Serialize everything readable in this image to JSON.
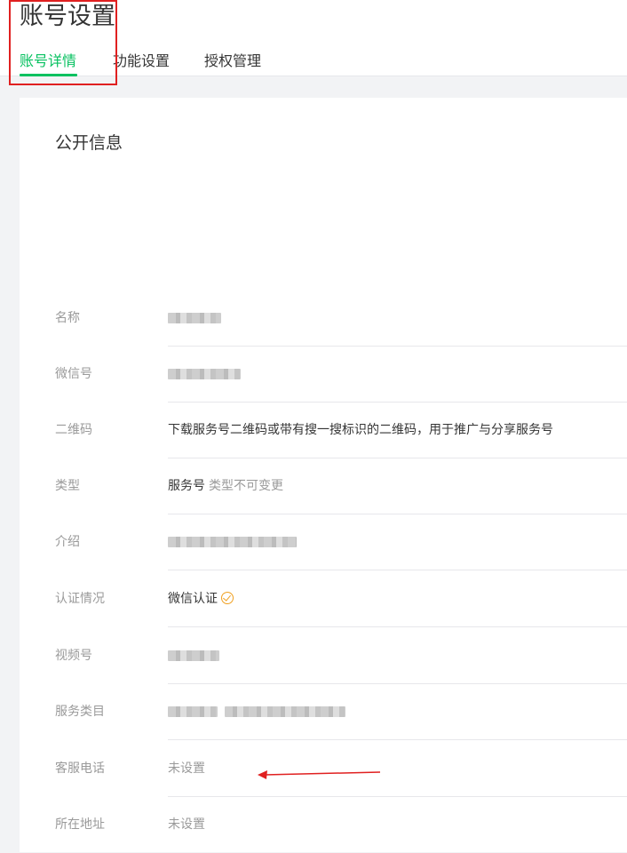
{
  "page": {
    "title": "账号设置",
    "tabs": [
      {
        "label": "账号详情",
        "active": true
      },
      {
        "label": "功能设置",
        "active": false
      },
      {
        "label": "授权管理",
        "active": false
      }
    ]
  },
  "section": {
    "title": "公开信息"
  },
  "rows": [
    {
      "label": "名称",
      "value": "",
      "redacted": true
    },
    {
      "label": "微信号",
      "value": "",
      "redacted": true
    },
    {
      "label": "二维码",
      "value": "下载服务号二维码或带有搜一搜标识的二维码，用于推广与分享服务号"
    },
    {
      "label": "类型",
      "value": "服务号",
      "note": "类型不可变更"
    },
    {
      "label": "介绍",
      "value": "",
      "redacted": true
    },
    {
      "label": "认证情况",
      "value": "微信认证",
      "icon": "verified-check-icon"
    },
    {
      "label": "视频号",
      "value": "",
      "redacted": true
    },
    {
      "label": "服务类目",
      "value": "",
      "redacted": true
    },
    {
      "label": "客服电话",
      "value": "未设置"
    },
    {
      "label": "所在地址",
      "value": "未设置"
    }
  ],
  "colors": {
    "accent": "#07c160",
    "annotation": "#e02020",
    "verified": "#f0a020"
  }
}
